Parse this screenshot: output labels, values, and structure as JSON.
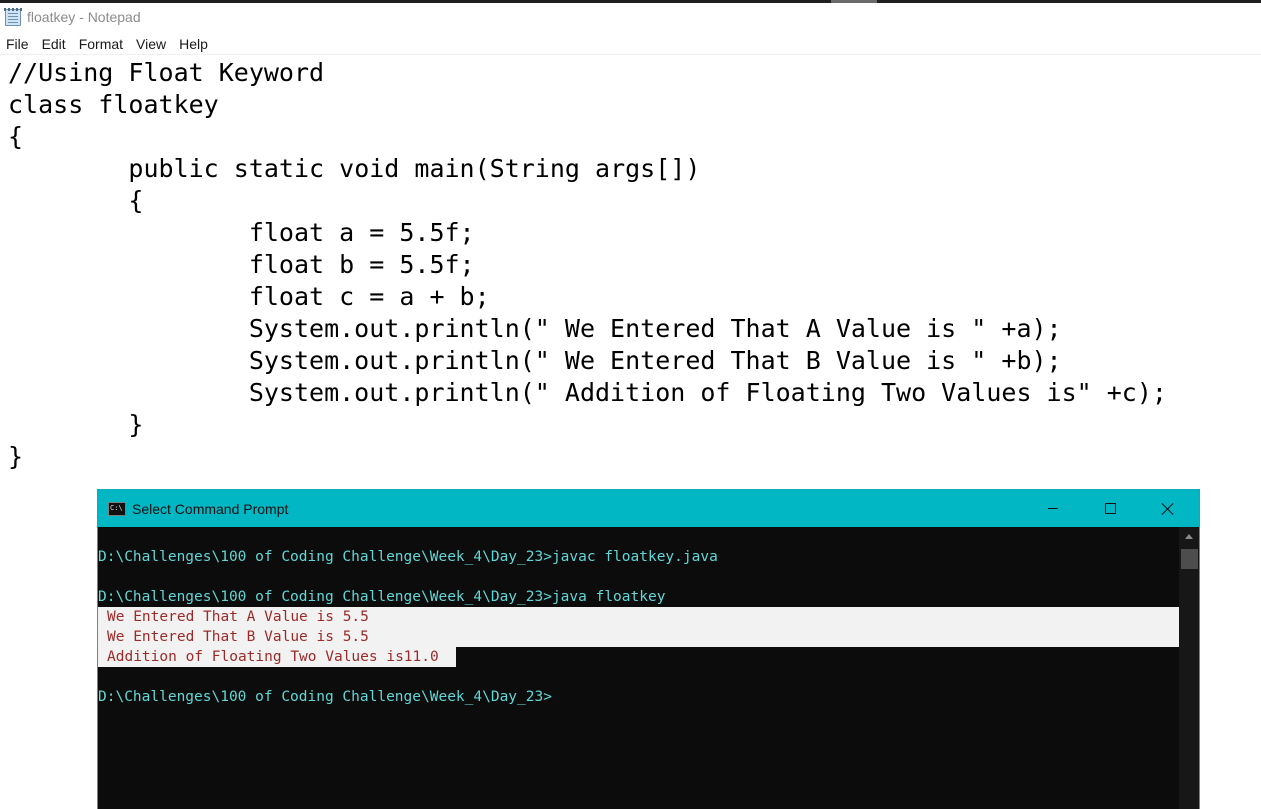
{
  "notepad": {
    "title": "floatkey - Notepad",
    "menu": [
      "File",
      "Edit",
      "Format",
      "View",
      "Help"
    ],
    "content": "//Using Float Keyword\nclass floatkey\n{\n\tpublic static void main(String args[])\n\t{\n\t\tfloat a = 5.5f;\n\t\tfloat b = 5.5f;\n\t\tfloat c = a + b;\n\t\tSystem.out.println(\" We Entered That A Value is \" +a);\n\t\tSystem.out.println(\" We Entered That B Value is \" +b);\n\t\tSystem.out.println(\" Addition of Floating Two Values is\" +c);\n\t}\n}"
  },
  "cmd": {
    "title": "Select Command Prompt",
    "icon": "cmd-icon",
    "controls": [
      "minimize-icon",
      "maximize-icon",
      "close-icon"
    ],
    "lines": [
      "D:\\Challenges\\100 of Coding Challenge\\Week_4\\Day_23>javac floatkey.java",
      "D:\\Challenges\\100 of Coding Challenge\\Week_4\\Day_23>java floatkey",
      "We Entered That A Value is 5.5",
      "We Entered That B Value is 5.5",
      "Addition of Floating Two Values is11.0",
      "D:\\Challenges\\100 of Coding Challenge\\Week_4\\Day_23>"
    ],
    "colors": {
      "prompt_text": "#61d6d6",
      "output_text": "#9c2a2a",
      "output_background": "#f2f2f2",
      "title_bar": "#00b7c3",
      "console_background": "#0c0c0c"
    }
  }
}
